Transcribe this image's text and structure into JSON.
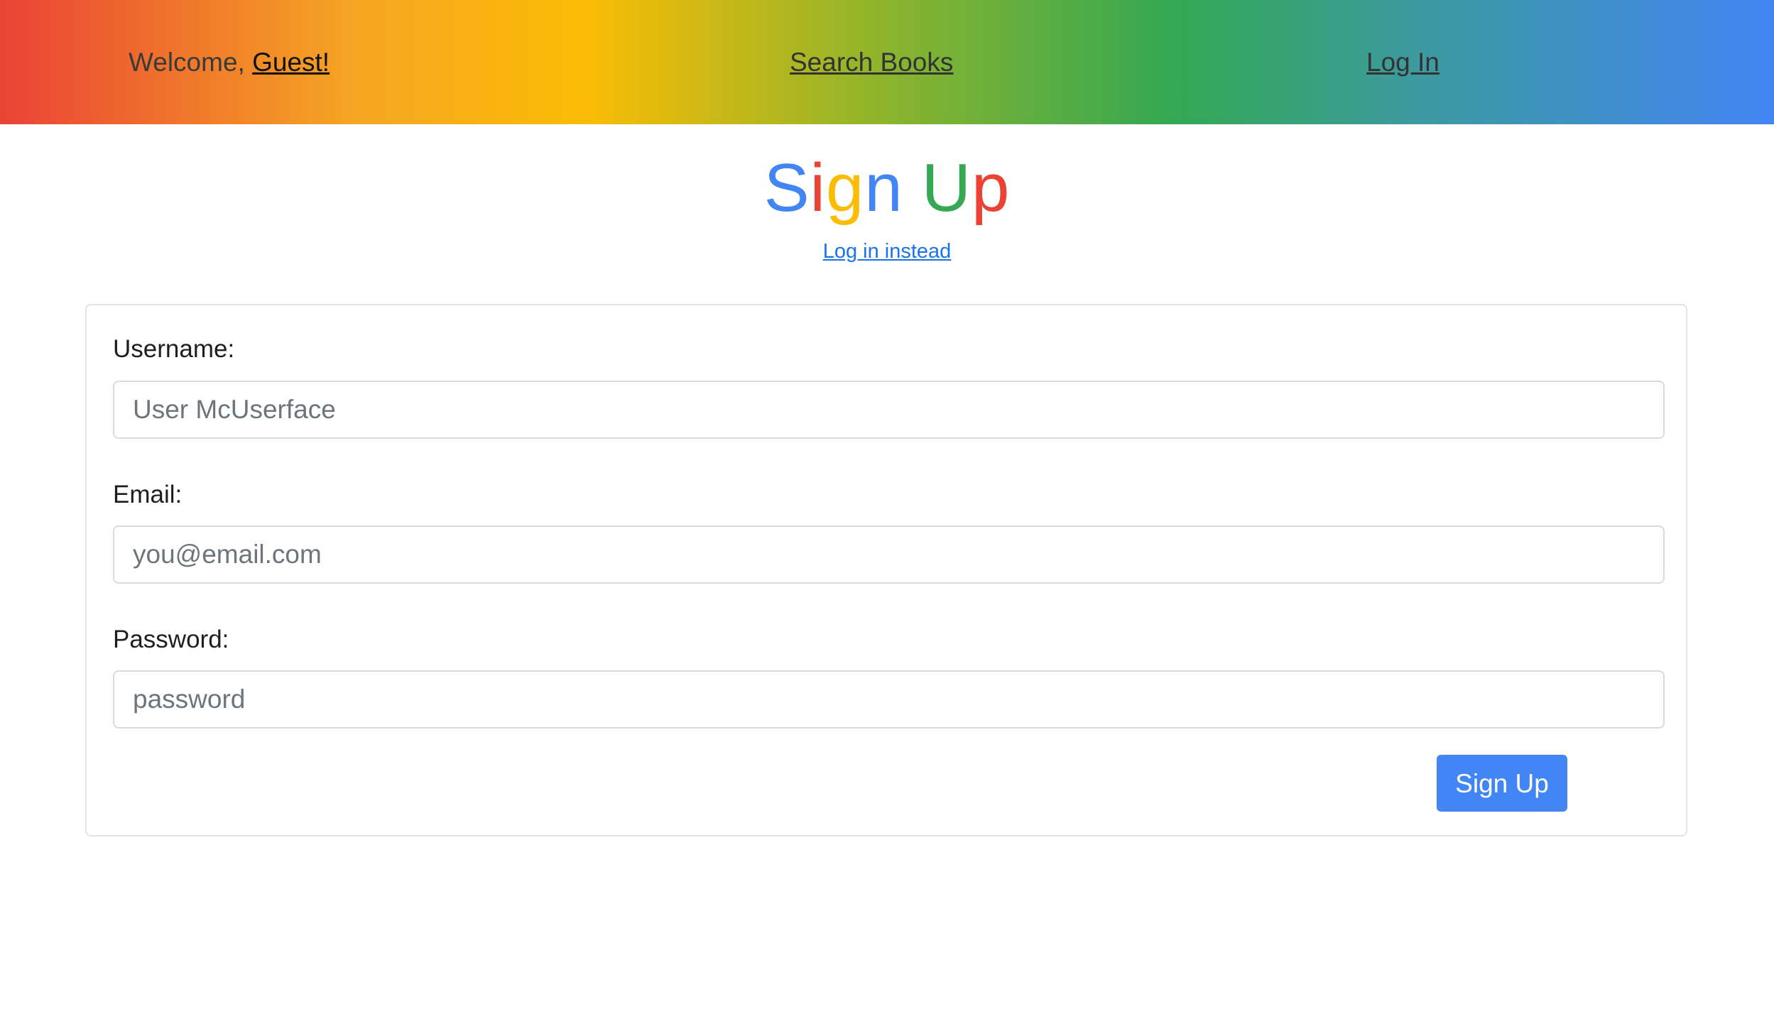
{
  "nav": {
    "welcome_prefix": "Welcome, ",
    "guest_label": "Guest!",
    "search_label": "Search Books",
    "login_label": "Log In"
  },
  "heading": {
    "letters": [
      {
        "char": "S",
        "color": "#4285f4"
      },
      {
        "char": "i",
        "color": "#ea4335"
      },
      {
        "char": "g",
        "color": "#fbbc05"
      },
      {
        "char": "n",
        "color": "#4285f4"
      },
      {
        "char": " ",
        "color": "#ffffff"
      },
      {
        "char": "U",
        "color": "#34a853"
      },
      {
        "char": "p",
        "color": "#ea4335"
      }
    ]
  },
  "alt_link": "Log in instead",
  "form": {
    "username_label": "Username:",
    "username_placeholder": "User McUserface",
    "email_label": "Email:",
    "email_placeholder": "you@email.com",
    "password_label": "Password:",
    "password_placeholder": "password",
    "submit_label": "Sign Up"
  },
  "colors": {
    "accent": "#4285f4",
    "link": "#1a73e8"
  }
}
